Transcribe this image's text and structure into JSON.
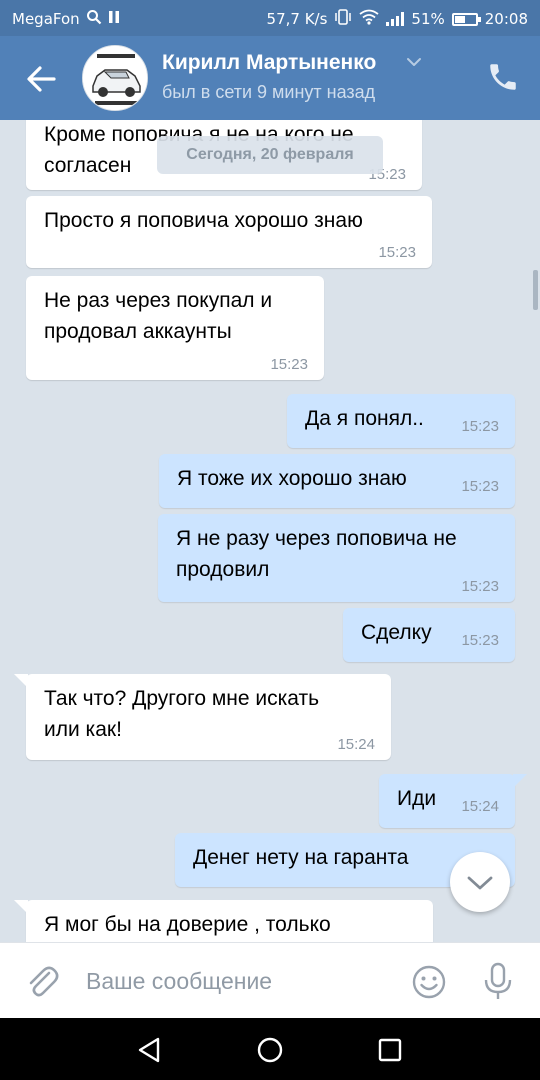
{
  "status_bar": {
    "carrier": "MegaFon",
    "speed": "57,7 K/s",
    "battery": "51%",
    "battery_level": 0.51,
    "time": "20:08"
  },
  "header": {
    "name": "Кирилл Мартыненко",
    "status": "был в сети 9 минут назад"
  },
  "chat": {
    "date_divider": "Сегодня, 20 февраля",
    "messages": [
      {
        "dir": "in",
        "lines": [
          "Кроме поповича я не на кого не",
          "согласен"
        ],
        "time": "15:23"
      },
      {
        "dir": "in",
        "lines": [
          "Просто я поповича хорошо знаю"
        ],
        "time": "15:23"
      },
      {
        "dir": "in",
        "lines": [
          "Не раз через покупал и",
          "продовал аккаунты"
        ],
        "time": "15:23"
      },
      {
        "dir": "out",
        "lines": [
          "Да я понял.."
        ],
        "time": "15:23"
      },
      {
        "dir": "out",
        "lines": [
          "Я тоже их хорошо знаю"
        ],
        "time": "15:23"
      },
      {
        "dir": "out",
        "lines": [
          "Я не разу через поповича не",
          "продовил"
        ],
        "time": "15:23"
      },
      {
        "dir": "out",
        "lines": [
          "Сделку"
        ],
        "time": "15:23"
      },
      {
        "dir": "in",
        "lines": [
          "Так что?  Другого мне искать",
          "или как!"
        ],
        "time": "15:24"
      },
      {
        "dir": "out",
        "lines": [
          "Иди"
        ],
        "time": "15:24"
      },
      {
        "dir": "out",
        "lines": [
          "Денег нету на гаранта"
        ],
        "time": ""
      },
      {
        "dir": "in",
        "lines": [
          "Я мог бы на доверие , только"
        ],
        "time": ""
      }
    ]
  },
  "composer": {
    "placeholder": "Ваше сообщение"
  },
  "colors": {
    "header": "#5181b8",
    "status_bar": "#4a76a8",
    "chat_background": "#dae2ea",
    "incoming_bubble": "#ffffff",
    "outgoing_bubble": "#cce4ff"
  },
  "icons": [
    "search-icon",
    "pause-icon",
    "vibrate-icon",
    "wifi-icon",
    "signal-icon",
    "battery-icon",
    "back-arrow-icon",
    "chevron-down-icon",
    "phone-icon",
    "paperclip-icon",
    "emoji-icon",
    "microphone-icon",
    "nav-back-icon",
    "nav-home-icon",
    "nav-recent-icon"
  ]
}
